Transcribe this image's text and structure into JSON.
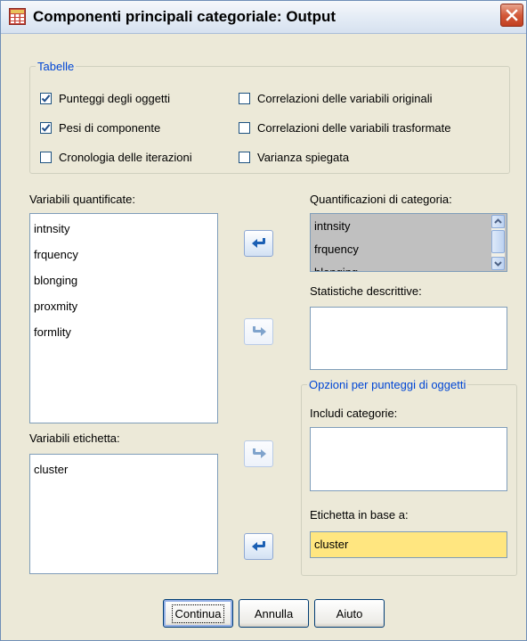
{
  "window": {
    "title": "Componenti principali categoriale: Output",
    "icon": "table-grid-icon",
    "accent_color": "#0046d5",
    "highlight_color": "#ffe680"
  },
  "tables_group": {
    "legend": "Tabelle",
    "options": [
      {
        "label": "Punteggi degli oggetti",
        "checked": true
      },
      {
        "label": "Pesi di componente",
        "checked": true
      },
      {
        "label": "Cronologia delle iterazioni",
        "checked": false
      },
      {
        "label": "Correlazioni delle variabili originali",
        "checked": false
      },
      {
        "label": "Correlazioni delle variabili trasformate",
        "checked": false
      },
      {
        "label": "Varianza spiegata",
        "checked": false
      }
    ]
  },
  "quantified_variables": {
    "label": "Variabili quantificate:",
    "items": [
      "intnsity",
      "frquency",
      "blonging",
      "proxmity",
      "formlity"
    ]
  },
  "category_quantifications": {
    "label": "Quantificazioni di categoria:",
    "items": [
      "intnsity",
      "frquency",
      "blonging"
    ]
  },
  "descriptive_statistics": {
    "label": "Statistiche descrittive:",
    "items": []
  },
  "label_variables": {
    "label": "Variabili etichetta:",
    "items": [
      "cluster"
    ]
  },
  "object_score_options": {
    "legend": "Opzioni per punteggi di oggetti",
    "include_categories_label": "Includi categorie:",
    "include_categories_items": [],
    "label_by_label": "Etichetta in base a:",
    "label_by_value": "cluster"
  },
  "buttons": {
    "continue": "Continua",
    "cancel": "Annulla",
    "help": "Aiuto"
  }
}
